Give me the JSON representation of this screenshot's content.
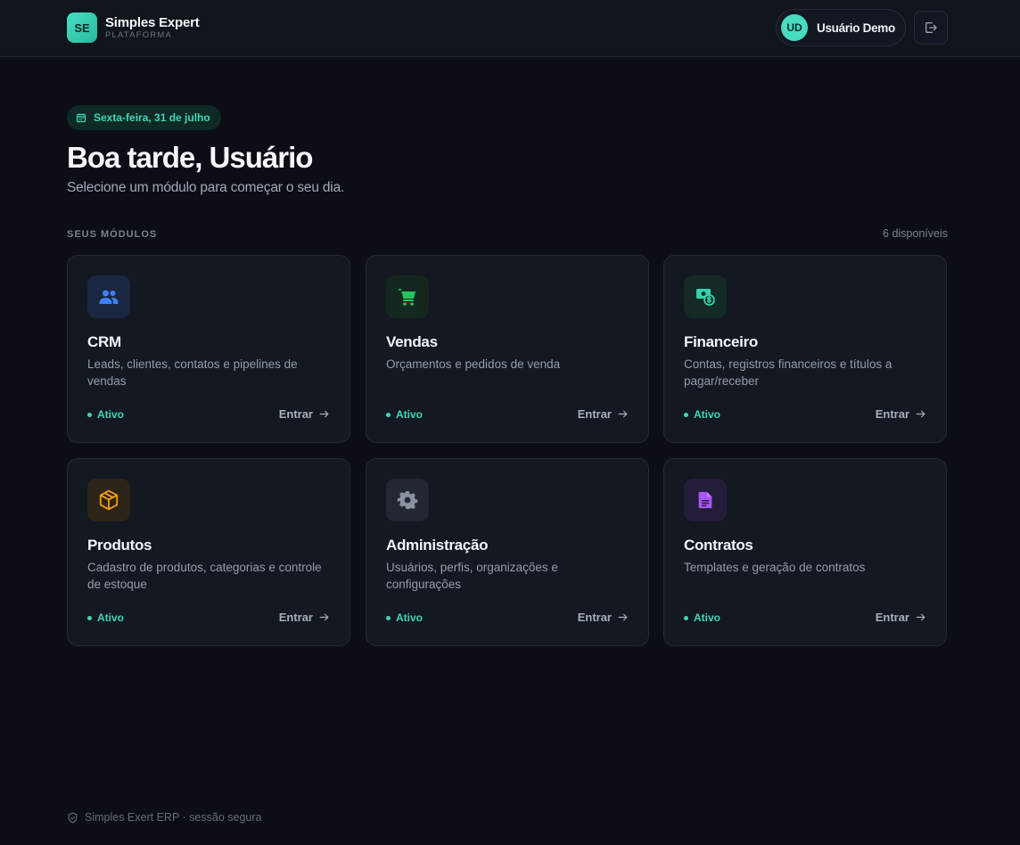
{
  "header": {
    "logo_initials": "SE",
    "brand_name": "Simples Expert",
    "brand_sub": "PLATAFORMA",
    "user_initials": "UD",
    "user_name": "Usuário Demo",
    "logout_icon": "logout-icon"
  },
  "hero": {
    "date": "Sexta-feira, 31 de julho",
    "greeting": "Boa tarde, Usuário",
    "subtitle": "Selecione um módulo para começar o seu dia."
  },
  "modules_section": {
    "label": "SEUS MÓDULOS",
    "count": "6 disponíveis"
  },
  "modules": [
    {
      "name": "CRM",
      "description": "Leads, clientes, contatos e pipelines de vendas",
      "status": "Ativo",
      "action": "Entrar",
      "icon": "users-icon",
      "color": "#3b82f6",
      "bg": "#1a2740"
    },
    {
      "name": "Vendas",
      "description": "Orçamentos e pedidos de venda",
      "status": "Ativo",
      "action": "Entrar",
      "icon": "cart-icon",
      "color": "#22c55e",
      "bg": "#15281f"
    },
    {
      "name": "Financeiro",
      "description": "Contas, registros financeiros e títulos a pagar/receber",
      "status": "Ativo",
      "action": "Entrar",
      "icon": "money-icon",
      "color": "#34d3a8",
      "bg": "#132a27"
    },
    {
      "name": "Produtos",
      "description": "Cadastro de produtos, categorias e controle de estoque",
      "status": "Ativo",
      "action": "Entrar",
      "icon": "box-icon",
      "color": "#f59e0b",
      "bg": "#2d2418"
    },
    {
      "name": "Administração",
      "description": "Usuários, perfis, organizações e configurações",
      "status": "Ativo",
      "action": "Entrar",
      "icon": "gear-icon",
      "color": "#8a929e",
      "bg": "#222732"
    },
    {
      "name": "Contratos",
      "description": "Templates e geração de contratos",
      "status": "Ativo",
      "action": "Entrar",
      "icon": "document-icon",
      "color": "#a855f7",
      "bg": "#241d3a"
    }
  ],
  "footer": {
    "text": "Simples Exert ERP · sessão segura"
  }
}
